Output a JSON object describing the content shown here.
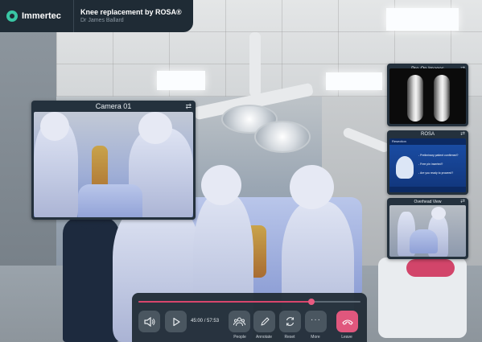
{
  "app": {
    "logo_text": "Immertec",
    "title": "Knee replacement by ROSA®",
    "subtitle": "Dr James Ballard"
  },
  "panels": {
    "camera": {
      "title": "Camera 01",
      "swap_icon": "swap-icon"
    },
    "preop": {
      "title": "Pre-Op Images",
      "swap_icon": "swap-icon"
    },
    "rosa": {
      "title": "ROSA",
      "header_text": "Resection",
      "lines": [
        "- Preliminary patient confirmed?",
        "- Free pin inserted?",
        "- Are you ready to proceed?"
      ],
      "swap_icon": "swap-icon"
    },
    "overhead": {
      "title": "Overhead View",
      "swap_icon": "swap-icon"
    }
  },
  "player": {
    "progress": 0.78,
    "time_current": "45:00",
    "time_total": "57:53",
    "time_separator": "/",
    "buttons": [
      {
        "icon": "speaker-icon",
        "label": ""
      },
      {
        "icon": "play-icon",
        "label": ""
      },
      {
        "icon": "people-icon",
        "label": "People"
      },
      {
        "icon": "pencil-icon",
        "label": "Annotate"
      },
      {
        "icon": "reset-icon",
        "label": "Reset"
      },
      {
        "icon": "more-icon",
        "label": "More"
      },
      {
        "icon": "phone-hangup-icon",
        "label": "Leave"
      }
    ],
    "accent_color": "#e0577d"
  }
}
